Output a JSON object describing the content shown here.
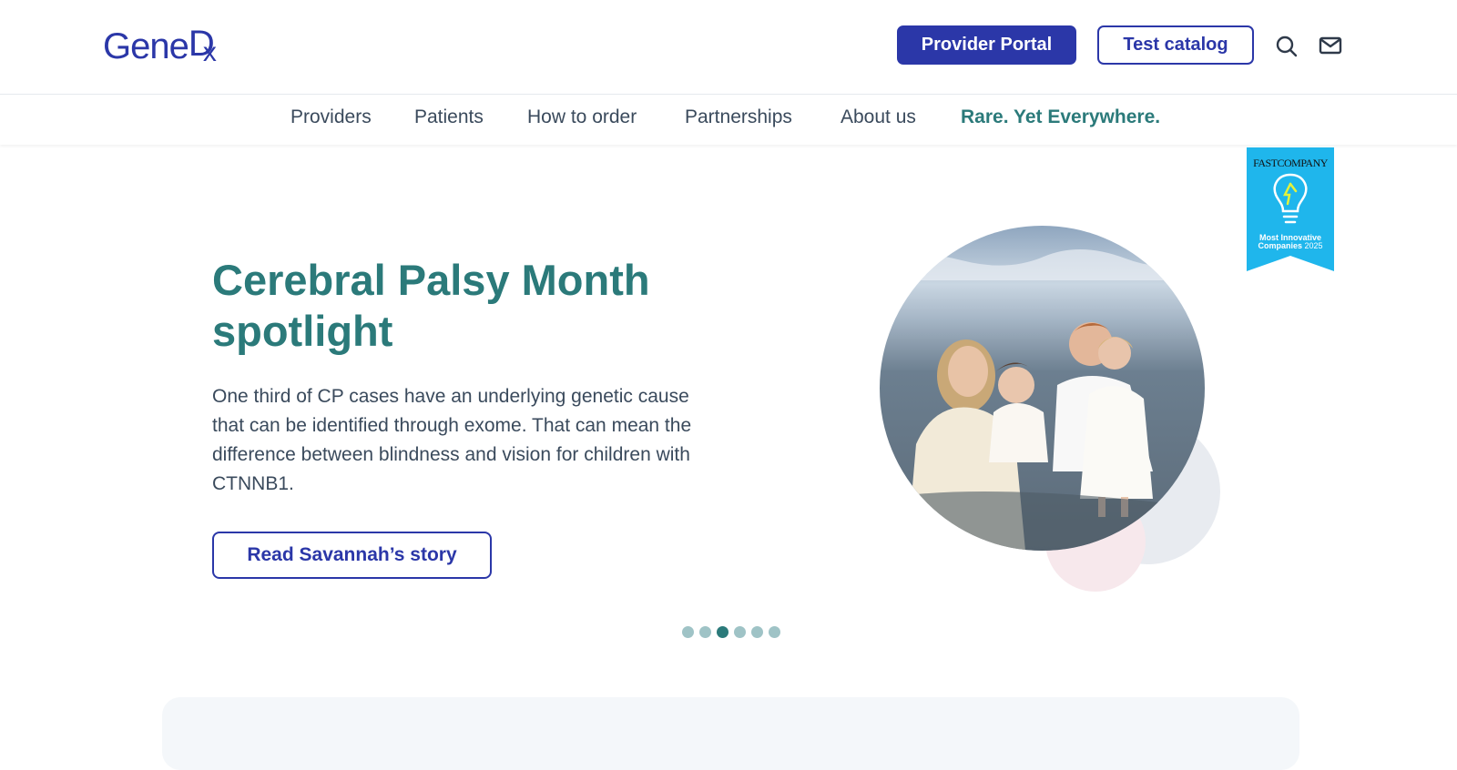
{
  "brand": {
    "logo_main": "Gene",
    "logo_d": "D",
    "logo_x": "x"
  },
  "header": {
    "provider_portal_label": "Provider Portal",
    "test_catalog_label": "Test catalog",
    "search_icon": "search-icon",
    "mail_icon": "mail-icon"
  },
  "nav": {
    "items": [
      {
        "label": "Providers"
      },
      {
        "label": "Patients"
      },
      {
        "label": "How to order"
      },
      {
        "label": "Partnerships"
      },
      {
        "label": "About us"
      },
      {
        "label": "Rare. Yet Everywhere."
      }
    ]
  },
  "hero": {
    "title": "Cerebral Palsy Month spotlight",
    "body": "One third of CP cases have an underlying genetic cause that can be identified through exome. That can mean the difference between blindness and vision for children with CTNNB1.",
    "cta_label": "Read Savannah’s story"
  },
  "badge": {
    "brand": "FASTCOMPANY",
    "line1": "Most Innovative",
    "line2": "Companies",
    "year": "2025"
  },
  "carousel": {
    "slide_count": 6,
    "active_index": 2
  },
  "colors": {
    "brand_blue": "#2b37a8",
    "teal": "#2b7a7a",
    "text": "#3a4a5c",
    "badge_blue": "#1fb6ec"
  }
}
